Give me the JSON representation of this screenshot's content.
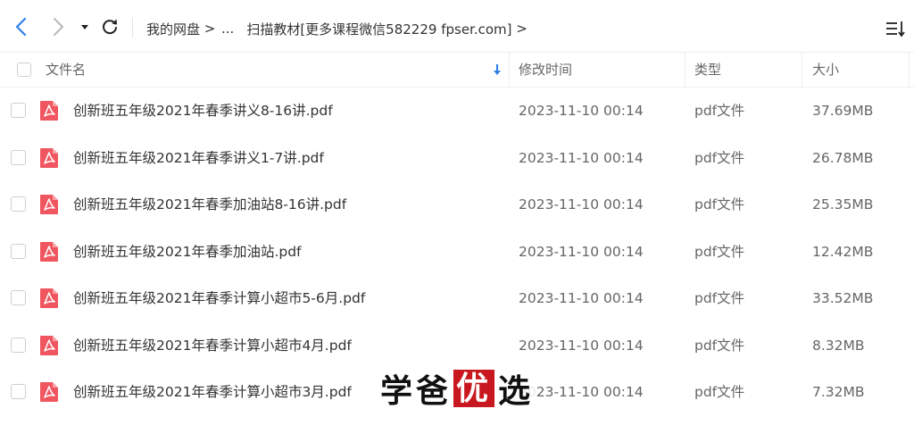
{
  "nav": {
    "back_icon": "chevron-left-icon",
    "forward_icon": "chevron-right-icon",
    "dropdown_icon": "caret-down-icon",
    "refresh_icon": "refresh-icon",
    "accent_color": "#2f7fe6"
  },
  "breadcrumb": {
    "root": "我的网盘",
    "separator": ">",
    "ellipsis": "...",
    "current": "扫描教材[更多课程微信582229 fpser.com]"
  },
  "toolbar": {
    "sort_menu_icon": "sort-list-icon"
  },
  "columns": {
    "name": "文件名",
    "modified": "修改时间",
    "type": "类型",
    "size": "大小",
    "sort_icon": "arrow-down-icon"
  },
  "files": [
    {
      "name": "创新班五年级2021年春季讲义8-16讲.pdf",
      "modified": "2023-11-10 00:14",
      "type": "pdf文件",
      "size": "37.69MB"
    },
    {
      "name": "创新班五年级2021年春季讲义1-7讲.pdf",
      "modified": "2023-11-10 00:14",
      "type": "pdf文件",
      "size": "26.78MB"
    },
    {
      "name": "创新班五年级2021年春季加油站8-16讲.pdf",
      "modified": "2023-11-10 00:14",
      "type": "pdf文件",
      "size": "25.35MB"
    },
    {
      "name": "创新班五年级2021年春季加油站.pdf",
      "modified": "2023-11-10 00:14",
      "type": "pdf文件",
      "size": "12.42MB"
    },
    {
      "name": "创新班五年级2021年春季计算小超市5-6月.pdf",
      "modified": "2023-11-10 00:14",
      "type": "pdf文件",
      "size": "33.52MB"
    },
    {
      "name": "创新班五年级2021年春季计算小超市4月.pdf",
      "modified": "2023-11-10 00:14",
      "type": "pdf文件",
      "size": "8.32MB"
    },
    {
      "name": "创新班五年级2021年春季计算小超市3月.pdf",
      "modified": "2023-11-10 00:14",
      "type": "pdf文件",
      "size": "7.32MB"
    }
  ],
  "file_icon": "pdf-file-icon",
  "pdf_icon_color": "#f0565f",
  "watermark": {
    "char1": "学",
    "char2": "爸",
    "char3": "优",
    "char4": "选",
    "highlight_color": "#c8171e"
  }
}
